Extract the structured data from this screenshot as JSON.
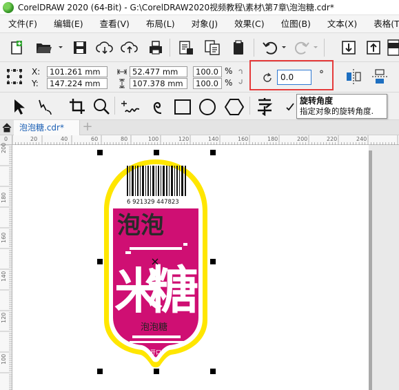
{
  "window": {
    "title": "CorelDRAW 2020 (64-Bit) - G:\\CorelDRAW2020视频教程\\素材\\第7章\\泡泡糖.cdr*"
  },
  "menu": [
    {
      "label": "文件(F)"
    },
    {
      "label": "编辑(E)"
    },
    {
      "label": "查看(V)"
    },
    {
      "label": "布局(L)"
    },
    {
      "label": "对象(J)"
    },
    {
      "label": "效果(C)"
    },
    {
      "label": "位图(B)"
    },
    {
      "label": "文本(X)"
    },
    {
      "label": "表格(T)"
    }
  ],
  "propbar": {
    "x_label": "X:",
    "x_value": "101.261 mm",
    "y_label": "Y:",
    "y_value": "147.224 mm",
    "w_value": "52.477 mm",
    "h_value": "107.378 mm",
    "scale_w": "100.0",
    "scale_h": "100.0",
    "percent": "%",
    "rotation_angle": "0.0",
    "degree_symbol": "°"
  },
  "tooltip": {
    "title": "旋转角度",
    "description": "指定对象的旋转角度."
  },
  "tab": {
    "label": "泡泡糖.cdr*",
    "add_symbol": "+"
  },
  "ruler": {
    "top_ticks": [
      "0",
      "20",
      "40",
      "60",
      "80",
      "100",
      "120",
      "140",
      "160",
      "180",
      "200",
      "220",
      "240"
    ],
    "left_ticks": [
      "200",
      "180",
      "160",
      "140",
      "120",
      "100"
    ]
  },
  "artwork": {
    "barcode_number": "6  921329  447823",
    "main_chars_top": "泡泡",
    "main_chars": "糖",
    "main_chars_left": "米",
    "sub_label": "泡泡糖",
    "tiny_label": "开口"
  },
  "colors": {
    "accent_red": "#e53a3a",
    "candy_magenta": "#cf0f73",
    "candy_yellow": "#ffe600",
    "link_blue": "#1a5fb4"
  }
}
